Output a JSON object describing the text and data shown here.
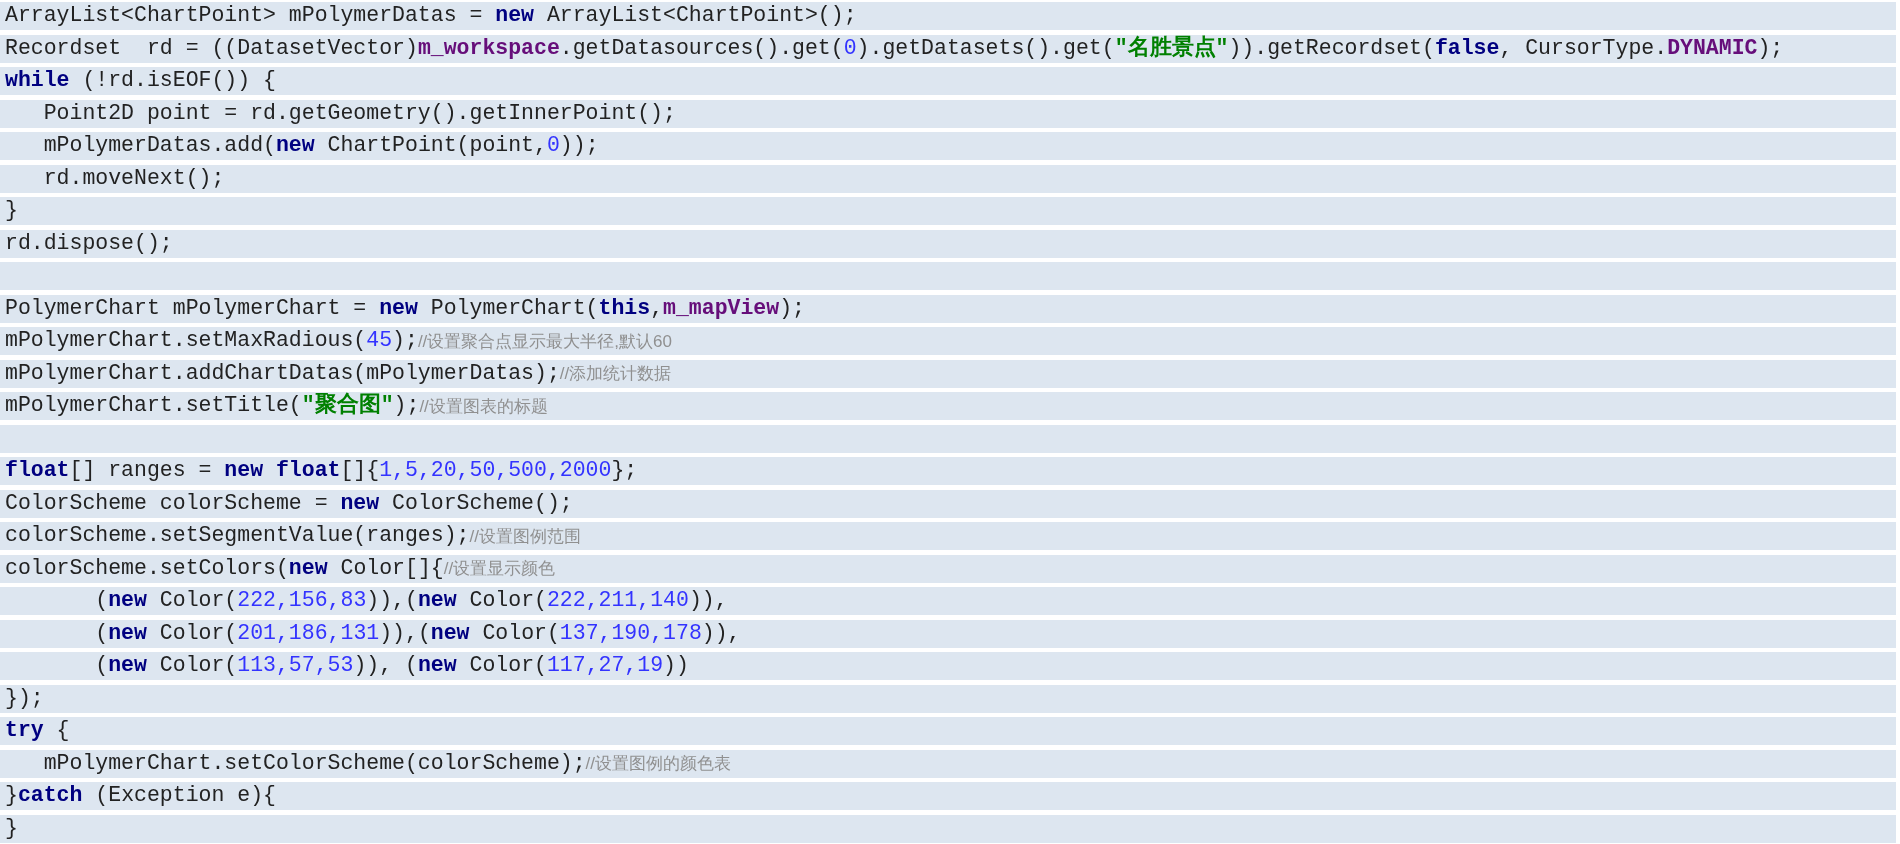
{
  "code_lines": [
    {
      "tokens": [
        {
          "kind": "plain",
          "text": "ArrayList<ChartPoint> mPolymerDatas = "
        },
        {
          "kind": "keyword",
          "text": "new"
        },
        {
          "kind": "plain",
          "text": " ArrayList<ChartPoint>();"
        }
      ]
    },
    {
      "tokens": [
        {
          "kind": "plain",
          "text": "Recordset  rd = ((DatasetVector)"
        },
        {
          "kind": "field",
          "text": "m_workspace"
        },
        {
          "kind": "plain",
          "text": ".getDatasources().get("
        },
        {
          "kind": "number",
          "text": "0"
        },
        {
          "kind": "plain",
          "text": ").getDatasets().get("
        },
        {
          "kind": "string",
          "text": "\"名胜景点\""
        },
        {
          "kind": "plain",
          "text": ")).getRecordset("
        },
        {
          "kind": "keyword",
          "text": "false"
        },
        {
          "kind": "plain",
          "text": ", CursorType."
        },
        {
          "kind": "field",
          "text": "DYNAMIC"
        },
        {
          "kind": "plain",
          "text": ");"
        }
      ]
    },
    {
      "tokens": [
        {
          "kind": "keyword",
          "text": "while"
        },
        {
          "kind": "plain",
          "text": " (!rd.isEOF()) {"
        }
      ]
    },
    {
      "tokens": [
        {
          "kind": "plain",
          "text": "   Point2D point = rd.getGeometry().getInnerPoint();"
        }
      ]
    },
    {
      "tokens": [
        {
          "kind": "plain",
          "text": "   mPolymerDatas.add("
        },
        {
          "kind": "keyword",
          "text": "new"
        },
        {
          "kind": "plain",
          "text": " ChartPoint(point,"
        },
        {
          "kind": "number",
          "text": "0"
        },
        {
          "kind": "plain",
          "text": "));"
        }
      ]
    },
    {
      "tokens": [
        {
          "kind": "plain",
          "text": "   rd.moveNext();"
        }
      ]
    },
    {
      "tokens": [
        {
          "kind": "plain",
          "text": "}"
        }
      ]
    },
    {
      "tokens": [
        {
          "kind": "plain",
          "text": "rd.dispose();"
        }
      ]
    },
    {
      "kind": "blank"
    },
    {
      "tokens": [
        {
          "kind": "plain",
          "text": "PolymerChart mPolymerChart = "
        },
        {
          "kind": "keyword",
          "text": "new"
        },
        {
          "kind": "plain",
          "text": " PolymerChart("
        },
        {
          "kind": "keyword",
          "text": "this"
        },
        {
          "kind": "plain",
          "text": ","
        },
        {
          "kind": "field",
          "text": "m_mapView"
        },
        {
          "kind": "plain",
          "text": ");"
        }
      ]
    },
    {
      "tokens": [
        {
          "kind": "plain",
          "text": "mPolymerChart.setMaxRadious("
        },
        {
          "kind": "number",
          "text": "45"
        },
        {
          "kind": "plain",
          "text": ");"
        },
        {
          "kind": "comment",
          "text": "//设置聚合点显示最大半径,默认60"
        }
      ]
    },
    {
      "tokens": [
        {
          "kind": "plain",
          "text": "mPolymerChart.addChartDatas(mPolymerDatas);"
        },
        {
          "kind": "comment",
          "text": "//添加统计数据"
        }
      ]
    },
    {
      "tokens": [
        {
          "kind": "plain",
          "text": "mPolymerChart.setTitle("
        },
        {
          "kind": "string",
          "text": "\"聚合图\""
        },
        {
          "kind": "plain",
          "text": ");"
        },
        {
          "kind": "comment",
          "text": "//设置图表的标题"
        }
      ]
    },
    {
      "kind": "blank"
    },
    {
      "tokens": [
        {
          "kind": "keyword",
          "text": "float"
        },
        {
          "kind": "plain",
          "text": "[] ranges = "
        },
        {
          "kind": "keyword",
          "text": "new float"
        },
        {
          "kind": "plain",
          "text": "[]{"
        },
        {
          "kind": "number",
          "text": "1,5,20,50,500,2000"
        },
        {
          "kind": "plain",
          "text": "};"
        }
      ]
    },
    {
      "tokens": [
        {
          "kind": "plain",
          "text": "ColorScheme colorScheme = "
        },
        {
          "kind": "keyword",
          "text": "new"
        },
        {
          "kind": "plain",
          "text": " ColorScheme();"
        }
      ]
    },
    {
      "tokens": [
        {
          "kind": "plain",
          "text": "colorScheme.setSegmentValue(ranges);"
        },
        {
          "kind": "comment",
          "text": "//设置图例范围"
        }
      ]
    },
    {
      "tokens": [
        {
          "kind": "plain",
          "text": "colorScheme.setColors("
        },
        {
          "kind": "keyword",
          "text": "new"
        },
        {
          "kind": "plain",
          "text": " Color[]{"
        },
        {
          "kind": "comment",
          "text": "//设置显示颜色"
        }
      ]
    },
    {
      "tokens": [
        {
          "kind": "plain",
          "text": "       ("
        },
        {
          "kind": "keyword",
          "text": "new"
        },
        {
          "kind": "plain",
          "text": " Color("
        },
        {
          "kind": "number",
          "text": "222,156,83"
        },
        {
          "kind": "plain",
          "text": ")),("
        },
        {
          "kind": "keyword",
          "text": "new"
        },
        {
          "kind": "plain",
          "text": " Color("
        },
        {
          "kind": "number",
          "text": "222,211,140"
        },
        {
          "kind": "plain",
          "text": ")),"
        }
      ]
    },
    {
      "tokens": [
        {
          "kind": "plain",
          "text": "       ("
        },
        {
          "kind": "keyword",
          "text": "new"
        },
        {
          "kind": "plain",
          "text": " Color("
        },
        {
          "kind": "number",
          "text": "201,186,131"
        },
        {
          "kind": "plain",
          "text": ")),("
        },
        {
          "kind": "keyword",
          "text": "new"
        },
        {
          "kind": "plain",
          "text": " Color("
        },
        {
          "kind": "number",
          "text": "137,190,178"
        },
        {
          "kind": "plain",
          "text": ")),"
        }
      ]
    },
    {
      "tokens": [
        {
          "kind": "plain",
          "text": "       ("
        },
        {
          "kind": "keyword",
          "text": "new"
        },
        {
          "kind": "plain",
          "text": " Color("
        },
        {
          "kind": "number",
          "text": "113,57,53"
        },
        {
          "kind": "plain",
          "text": ")), ("
        },
        {
          "kind": "keyword",
          "text": "new"
        },
        {
          "kind": "plain",
          "text": " Color("
        },
        {
          "kind": "number",
          "text": "117,27,19"
        },
        {
          "kind": "plain",
          "text": "))"
        }
      ]
    },
    {
      "tokens": [
        {
          "kind": "plain",
          "text": "});"
        }
      ]
    },
    {
      "tokens": [
        {
          "kind": "keyword",
          "text": "try"
        },
        {
          "kind": "plain",
          "text": " {"
        }
      ]
    },
    {
      "tokens": [
        {
          "kind": "plain",
          "text": "   mPolymerChart.setColorScheme(colorScheme);"
        },
        {
          "kind": "comment",
          "text": "//设置图例的颜色表"
        }
      ]
    },
    {
      "tokens": [
        {
          "kind": "plain",
          "text": "}"
        },
        {
          "kind": "keyword",
          "text": "catch"
        },
        {
          "kind": "plain",
          "text": " (Exception e){"
        }
      ]
    },
    {
      "tokens": [
        {
          "kind": "plain",
          "text": "}"
        }
      ]
    }
  ]
}
